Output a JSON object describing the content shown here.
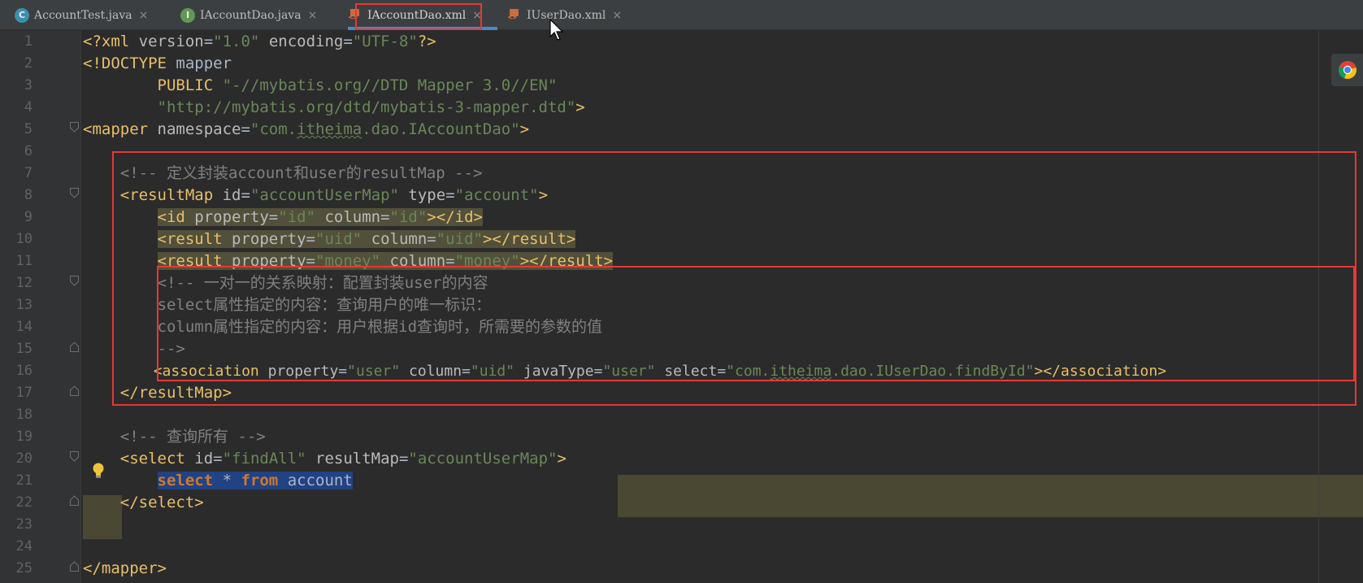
{
  "tabs": [
    {
      "icon": "c-class-icon",
      "icon_letter": "C",
      "label": "AccountTest.java",
      "close": "×"
    },
    {
      "icon": "i-interface-icon",
      "icon_letter": "I",
      "label": "IAccountDao.java",
      "close": "×"
    },
    {
      "icon": "xml-file-icon",
      "label": "IAccountDao.xml",
      "close": "×",
      "active": true
    },
    {
      "icon": "xml-file-icon",
      "label": "IUserDao.xml",
      "close": "×"
    }
  ],
  "line_numbers": [
    "1",
    "2",
    "3",
    "4",
    "5",
    "6",
    "7",
    "8",
    "9",
    "10",
    "11",
    "12",
    "13",
    "14",
    "15",
    "16",
    "17",
    "18",
    "19",
    "20",
    "21",
    "22",
    "23",
    "24",
    "25"
  ],
  "code": {
    "l1": {
      "a": "<?xml ",
      "b": "version",
      "c": "=",
      "d": "\"1.0\"",
      "e": " encoding",
      "f": "=",
      "g": "\"UTF-8\"",
      "h": "?>"
    },
    "l2": {
      "a": "<!DOCTYPE ",
      "b": "mapper"
    },
    "l3": {
      "a": "        PUBLIC ",
      "b": "\"-//mybatis.org//DTD Mapper 3.0//EN\""
    },
    "l4": {
      "a": "        ",
      "b": "\"http://mybatis.org/dtd/mybatis-3-mapper.dtd\"",
      "c": ">"
    },
    "l5": {
      "a": "<mapper ",
      "b": "namespace",
      "c": "=",
      "d": "\"com.",
      "e": "itheima",
      "f": ".dao.IAccountDao\"",
      "g": ">"
    },
    "l7": "    <!-- 定义封装account和user的resultMap -->",
    "l8": {
      "a": "    ",
      "b": "<resultMap ",
      "c": "id",
      "d": "=",
      "e": "\"accountUserMap\"",
      "f": " type",
      "g": "=",
      "h": "\"account\"",
      "i": ">"
    },
    "l9": {
      "a": "        ",
      "b": "<id ",
      "c": "property",
      "d": "=",
      "e": "\"id\"",
      "f": " column",
      "g": "=",
      "h": "\"id\"",
      "i": "></id>"
    },
    "l10": {
      "a": "        ",
      "b": "<result ",
      "c": "property",
      "d": "=",
      "e": "\"uid\"",
      "f": " column",
      "g": "=",
      "h": "\"uid\"",
      "i": "></result>"
    },
    "l11": {
      "a": "        ",
      "b": "<result ",
      "c": "property",
      "d": "=",
      "e": "\"money\"",
      "f": " column",
      "g": "=",
      "h": "\"money\"",
      "i": "></result>"
    },
    "l12": "        <!-- 一对一的关系映射：配置封装user的内容",
    "l13": "        select属性指定的内容：查询用户的唯一标识：",
    "l14": "        column属性指定的内容：用户根据id查询时，所需要的参数的值",
    "l15": "        -->",
    "l16": {
      "a": "        ",
      "b": "<association ",
      "c": "property",
      "d": "=",
      "e": "\"user\"",
      "f": " column",
      "g": "=",
      "h": "\"uid\"",
      "i": " javaType",
      "j": "=",
      "k": "\"user\"",
      "l": " select",
      "m": "=",
      "n": "\"com.",
      "o": "itheima",
      "p": ".dao.IUserDao.findById\"",
      "q": "></association>"
    },
    "l17": {
      "a": "    ",
      "b": "</resultMap>"
    },
    "l19": "    <!-- 查询所有 -->",
    "l20": {
      "a": "    ",
      "b": "<select ",
      "c": "id",
      "d": "=",
      "e": "\"findAll\"",
      "f": " resultMap",
      "g": "=",
      "h": "\"accountUserMap\"",
      "i": ">"
    },
    "l21": {
      "a": "        ",
      "b": "select",
      "c": " * ",
      "d": "from",
      "e": " account"
    },
    "l22": {
      "a": "    ",
      "b": "</select>"
    },
    "l25": {
      "a": "</mapper>"
    }
  },
  "colors": {
    "highlight": "#e53935",
    "tag": "#e8bf6a",
    "value": "#6a8759",
    "comment": "#808080",
    "keyword": "#cc7832"
  }
}
